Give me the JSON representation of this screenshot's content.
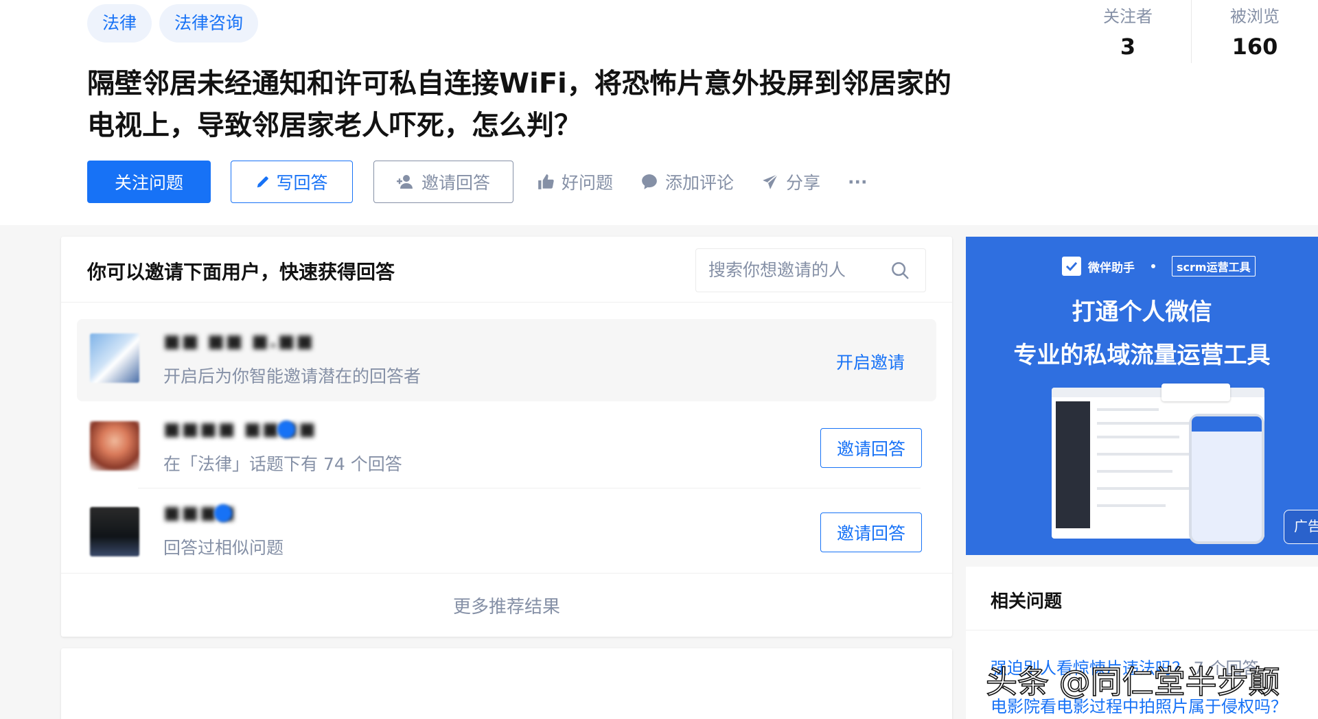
{
  "question": {
    "tags": [
      "法律",
      "法律咨询"
    ],
    "title": "隔壁邻居未经通知和许可私自连接WiFi，将恐怖片意外投屏到邻居家的电视上，导致邻居家老人吓死，怎么判？",
    "stats": {
      "followers_label": "关注者",
      "followers": "3",
      "views_label": "被浏览",
      "views": "160"
    },
    "actions": {
      "follow": "关注问题",
      "write": "写回答",
      "invite": "邀请回答",
      "good": "好问题",
      "comment": "添加评论",
      "share": "分享",
      "more": "···"
    }
  },
  "invite": {
    "title": "你可以邀请下面用户，快速获得回答",
    "search_placeholder": "搜索你想邀请的人",
    "users": [
      {
        "name": "■■ ■■ ■.■■",
        "desc": "开启后为你智能邀请潜在的回答者",
        "action": "开启邀请"
      },
      {
        "name": "■■■■ ■■■■",
        "desc": "在「法律」话题下有 74 个回答",
        "action": "邀请回答"
      },
      {
        "name": "■■■■",
        "desc": "回答过相似问题",
        "action": "邀请回答"
      }
    ],
    "more": "更多推荐结果"
  },
  "ad": {
    "brand": "微伴助手",
    "tag": "scrm运营工具",
    "line1": "打通个人微信",
    "line2": "专业的私域流量运营工具",
    "label": "广告"
  },
  "related": {
    "title": "相关问题",
    "items": [
      {
        "text": "强迫别人看惊悚片违法吗？",
        "count": "7 个回答"
      },
      {
        "text": "电影院看电影过程中拍照片属于侵权吗？",
        "count": ""
      }
    ]
  },
  "watermark": "头条 @同仁堂半步颠",
  "colors": {
    "accent": "#1772f6",
    "muted": "#8590a6",
    "ad_bg": "#2f6fe0"
  }
}
